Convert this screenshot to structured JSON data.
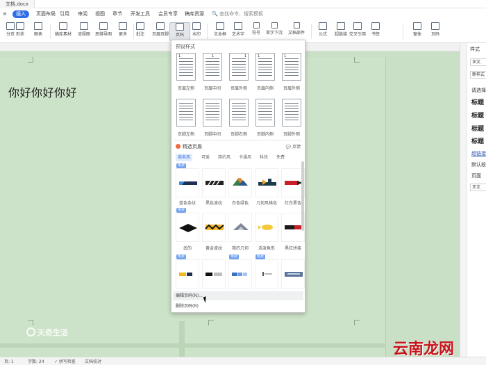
{
  "titlebar": {
    "doc_name": "文档.docx"
  },
  "menu": {
    "items": [
      "≡",
      "插入",
      "页面布局",
      "引用",
      "审阅",
      "视图",
      "章节",
      "开发工具",
      "会员专享",
      "稿库资源"
    ],
    "active_index": 1,
    "search": "🔍 查找命令、搜索模板"
  },
  "ribbon": {
    "buttons": [
      "分页",
      "形状",
      "图表",
      "智能图形",
      "稿库素材",
      "流程图",
      "思维导图",
      "更多",
      "批注",
      "页眉页脚",
      "页码",
      "水印",
      "文本框",
      "艺术字",
      "符号",
      "公式",
      "超链接",
      "交叉引用",
      "书签",
      "窗体",
      "首字下沉",
      "文档部件"
    ]
  },
  "document": {
    "text": "你好你好你好"
  },
  "panel": {
    "header": "预设样式",
    "presets_row1": [
      {
        "label": "页眉左侧",
        "num": "1"
      },
      {
        "label": "页眉中间",
        "num": "1"
      },
      {
        "label": "页眉外侧",
        "num": "1"
      },
      {
        "label": "页眉内侧",
        "num": "1"
      },
      {
        "label": "页眉外侧",
        "num": "1"
      }
    ],
    "presets_row2": [
      {
        "label": "页脚左侧",
        "num": ""
      },
      {
        "label": "页脚中间",
        "num": ""
      },
      {
        "label": "页脚右侧",
        "num": ""
      },
      {
        "label": "页脚内侧",
        "num": ""
      },
      {
        "label": "页脚外侧",
        "num": ""
      }
    ],
    "fine_title": "精选页眉",
    "feedback": "💬 反馈",
    "tabs": [
      "商务风",
      "可爱",
      "简约风",
      "卡通风",
      "科技",
      "免费"
    ],
    "active_tab": 0,
    "badge": "免费",
    "templates_row1_labels": [
      "蓝色条纹",
      "黑色波纹",
      "白色绿色",
      "几何风格色",
      "红白黑色"
    ],
    "templates_row2_labels": [
      "武的",
      "黄金波纹",
      "简约几何",
      "活泼鱼形",
      "黑红拼接"
    ],
    "footer_edit": "编辑页码(N)...",
    "footer_delete": "删除页码(R)"
  },
  "colors": {
    "accent": "#2f6ee8",
    "page_bg": "#cde3c9",
    "workspace_bg": "#c9dfc6"
  },
  "rightpane": {
    "top_label": "样式",
    "box1": "正文",
    "box2": "新样式",
    "section": "请选择",
    "headings": [
      "标题",
      "标题",
      "标题",
      "标题"
    ],
    "link_text": "超链接",
    "default_para": "默认段",
    "page_ref": "页面",
    "box3": "正文"
  },
  "status": {
    "page": "页: 1",
    "words": "字数: 24",
    "spell": "✓ 拼写检查",
    "docs": "文档校对"
  },
  "watermarks": {
    "left": "天奇生活",
    "right": "云南龙网"
  }
}
